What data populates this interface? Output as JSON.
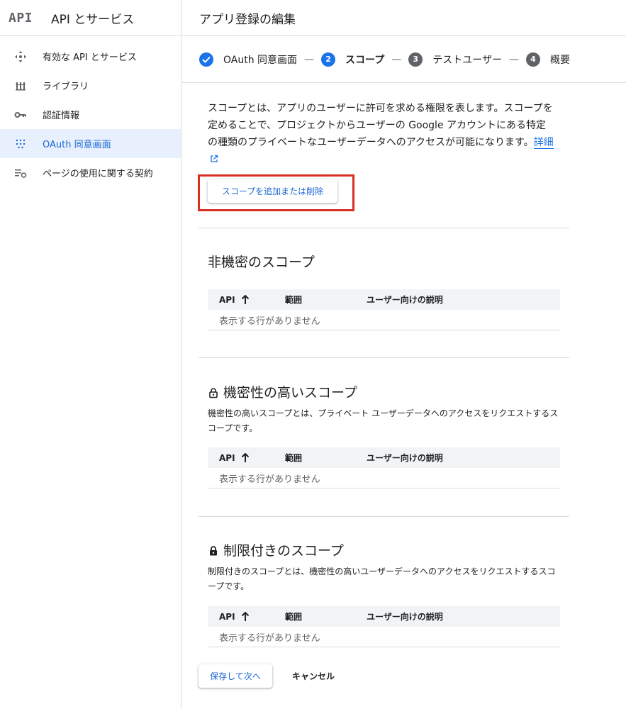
{
  "sidebar": {
    "logo": "API",
    "title": "API とサービス",
    "items": [
      {
        "label": "有効な API とサービス",
        "icon": "enabled-apis-icon"
      },
      {
        "label": "ライブラリ",
        "icon": "library-icon"
      },
      {
        "label": "認証情報",
        "icon": "key-icon"
      },
      {
        "label": "OAuth 同意画面",
        "icon": "oauth-consent-icon",
        "active": true
      },
      {
        "label": "ページの使用に関する契約",
        "icon": "page-usage-agreement-icon"
      }
    ]
  },
  "main": {
    "title": "アプリ登録の編集",
    "steps": [
      {
        "label": "OAuth 同意画面",
        "state": "done"
      },
      {
        "number": "2",
        "label": "スコープ",
        "state": "active"
      },
      {
        "number": "3",
        "label": "テストユーザー",
        "state": "pending"
      },
      {
        "number": "4",
        "label": "概要",
        "state": "pending"
      }
    ],
    "dash": "—",
    "description": "スコープとは、アプリのユーザーに許可を求める権限を表します。スコープを定めることで、プロジェクトからユーザーの Google アカウントにある特定の種類のプライベートなユーザーデータへのアクセスが可能になります。",
    "learn_more": "詳細",
    "add_scope_button": "スコープを追加または削除",
    "table_headers": {
      "api": "API",
      "scope": "範囲",
      "desc": "ユーザー向けの説明"
    },
    "empty_text": "表示する行がありません",
    "sections": {
      "non_sensitive": {
        "title": "非機密のスコープ"
      },
      "sensitive": {
        "title": "機密性の高いスコープ",
        "desc": "機密性の高いスコープとは、プライベート ユーザーデータへのアクセスをリクエストするスコープです。"
      },
      "restricted": {
        "title": "制限付きのスコープ",
        "desc": "制限付きのスコープとは、機密性の高いユーザーデータへのアクセスをリクエストするスコープです。"
      }
    },
    "save_button": "保存して次へ",
    "cancel_button": "キャンセル"
  },
  "colors": {
    "accent": "#1a73e8",
    "highlight_box": "#d93025",
    "active_bg": "#e8f0fe"
  }
}
